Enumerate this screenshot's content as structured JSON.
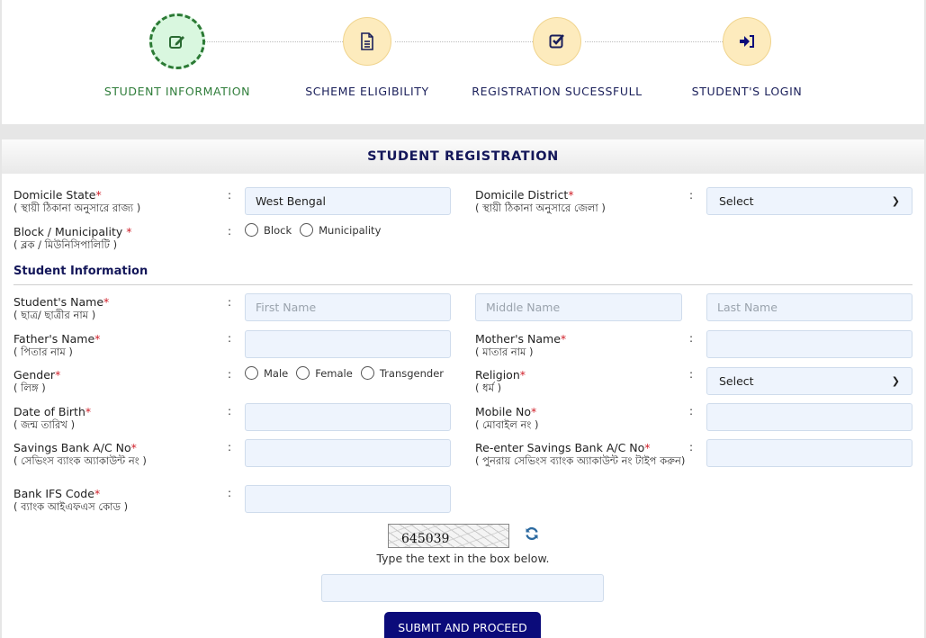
{
  "stepper": {
    "steps": [
      {
        "label": "STUDENT INFORMATION",
        "icon": "edit-icon",
        "active": true
      },
      {
        "label": "SCHEME ELIGIBILITY",
        "icon": "document-icon",
        "active": false
      },
      {
        "label": "REGISTRATION SUCESSFULL",
        "icon": "check-square-icon",
        "active": false
      },
      {
        "label": "STUDENT'S LOGIN",
        "icon": "sign-in-icon",
        "active": false
      }
    ]
  },
  "colors": {
    "active_step": "#2f7d3a",
    "navy": "#14175a",
    "required": "#d0202a",
    "button": "#0b0b7a",
    "input_bg": "#eef4fd"
  },
  "panel": {
    "title": "STUDENT REGISTRATION"
  },
  "form": {
    "domicile_state": {
      "label": "Domicile State",
      "sub": "( স্থায়ী ঠিকানা অনুসারে রাজ্য )",
      "value": "West Bengal"
    },
    "domicile_district": {
      "label": "Domicile District",
      "sub": "( স্থায়ী ঠিকানা অনুসারে জেলা )",
      "selected": "Select"
    },
    "block_municipality": {
      "label": "Block / Municipality ",
      "sub": "( ব্লক / মিউনিসিপালিটি )",
      "options": [
        "Block",
        "Municipality"
      ]
    },
    "section_title": "Student Information",
    "student_name": {
      "label": "Student's Name",
      "sub": "( ছাত্র/ ছাত্রীর নাম )",
      "first_placeholder": "First Name",
      "middle_placeholder": "Middle Name",
      "last_placeholder": "Last Name"
    },
    "father_name": {
      "label": "Father's Name",
      "sub": "( পিতার নাম )",
      "value": ""
    },
    "mother_name": {
      "label": "Mother's Name",
      "sub": "( মাতার নাম )",
      "value": ""
    },
    "gender": {
      "label": "Gender",
      "sub": "( লিঙ্গ )",
      "options": [
        "Male",
        "Female",
        "Transgender"
      ]
    },
    "religion": {
      "label": "Religion",
      "sub": "( ধর্ম )",
      "selected": "Select"
    },
    "dob": {
      "label": "Date of Birth",
      "sub": "( জন্ম তারিখ )",
      "value": ""
    },
    "mobile": {
      "label": "Mobile No",
      "sub": "( মোবাইল নং )",
      "value": ""
    },
    "bank_ac": {
      "label": "Savings Bank A/C No",
      "sub": "( সেভিংস ব্যাংক অ্যাকাউন্ট নং )",
      "value": ""
    },
    "bank_ac_reenter": {
      "label": "Re-enter Savings Bank A/C No",
      "sub": "( পুনরায় সেভিংস ব্যাংক অ্যাকাউন্ট নং টাইপ করুন)",
      "value": ""
    },
    "ifsc": {
      "label": "Bank IFS Code",
      "sub": "( ব্যাংক আইএফএস কোড )",
      "value": ""
    },
    "required_mark": "*",
    "colon": ":"
  },
  "captcha": {
    "text": "645039",
    "hint": "Type the text in the box below.",
    "value": ""
  },
  "submit_label": "SUBMIT AND PROCEED"
}
